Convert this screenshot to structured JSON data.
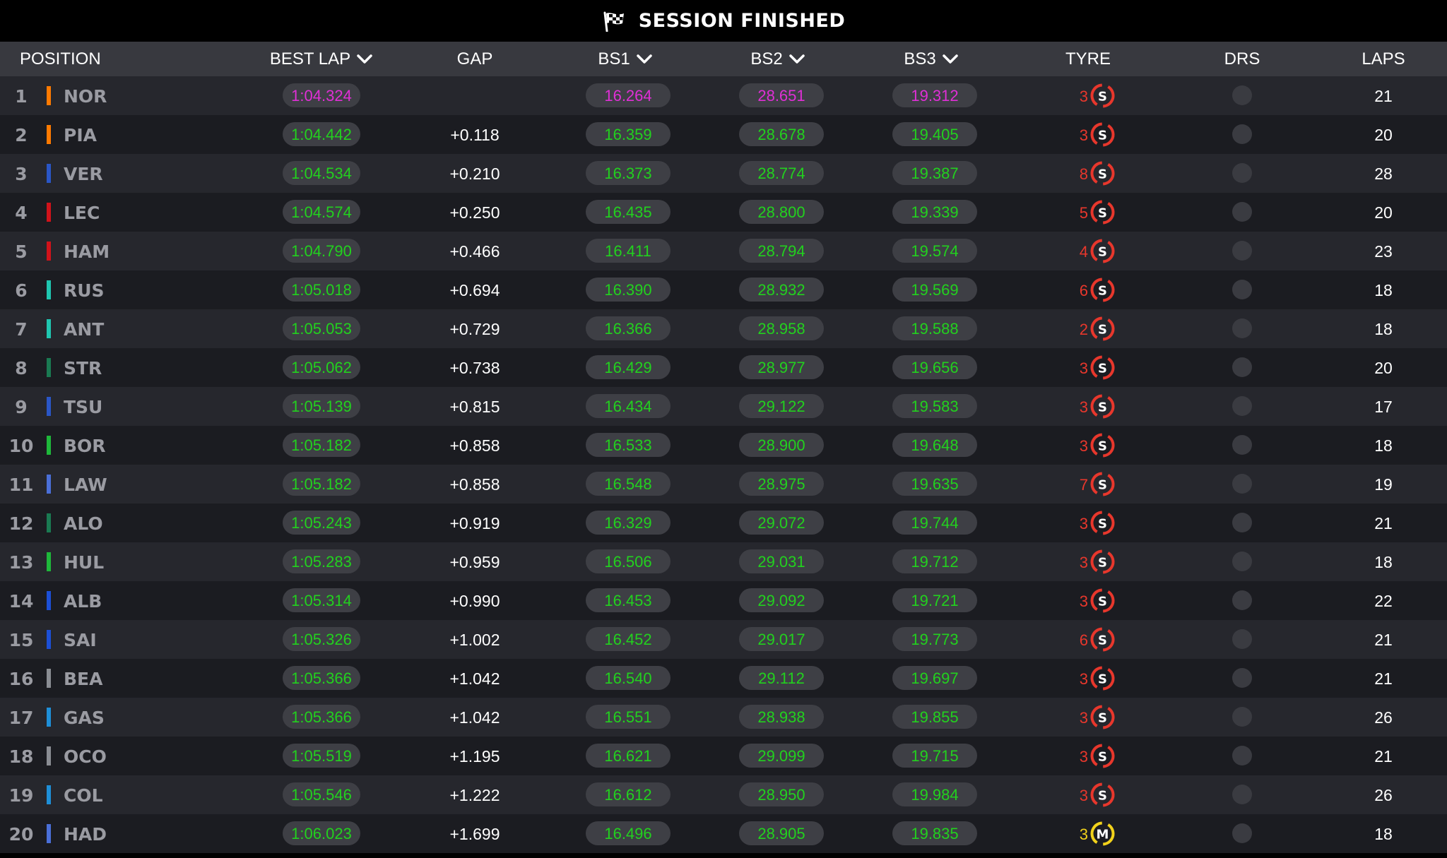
{
  "banner": {
    "title": "SESSION FINISHED",
    "icon": "checkered-flag-icon"
  },
  "columns": {
    "position": "POSITION",
    "best_lap": "BEST LAP",
    "gap": "GAP",
    "bs1": "BS1",
    "bs2": "BS2",
    "bs3": "BS3",
    "tyre": "TYRE",
    "drs": "DRS",
    "laps": "LAPS"
  },
  "colors": {
    "personal_best": "#22d11e",
    "overall_best": "#e02fd6",
    "soft_tyre": "#e8372c",
    "medium_tyre": "#f2d21b"
  },
  "rows": [
    {
      "pos": "1",
      "driver": "NOR",
      "team_color": "#ff7a00",
      "best_lap": "1:04.324",
      "best_lap_purple": true,
      "gap": "",
      "bs1": "16.264",
      "bs1_purple": true,
      "bs2": "28.651",
      "bs2_purple": true,
      "bs3": "19.312",
      "bs3_purple": true,
      "tyre_age": "3",
      "tyre": "S",
      "laps": "21"
    },
    {
      "pos": "2",
      "driver": "PIA",
      "team_color": "#ff7a00",
      "best_lap": "1:04.442",
      "gap": "+0.118",
      "bs1": "16.359",
      "bs2": "28.678",
      "bs3": "19.405",
      "tyre_age": "3",
      "tyre": "S",
      "laps": "20"
    },
    {
      "pos": "3",
      "driver": "VER",
      "team_color": "#2a56c6",
      "best_lap": "1:04.534",
      "gap": "+0.210",
      "bs1": "16.373",
      "bs2": "28.774",
      "bs3": "19.387",
      "tyre_age": "8",
      "tyre": "S",
      "laps": "28"
    },
    {
      "pos": "4",
      "driver": "LEC",
      "team_color": "#d1121a",
      "best_lap": "1:04.574",
      "gap": "+0.250",
      "bs1": "16.435",
      "bs2": "28.800",
      "bs3": "19.339",
      "tyre_age": "5",
      "tyre": "S",
      "laps": "20"
    },
    {
      "pos": "5",
      "driver": "HAM",
      "team_color": "#d1121a",
      "best_lap": "1:04.790",
      "gap": "+0.466",
      "bs1": "16.411",
      "bs2": "28.794",
      "bs3": "19.574",
      "tyre_age": "4",
      "tyre": "S",
      "laps": "23"
    },
    {
      "pos": "6",
      "driver": "RUS",
      "team_color": "#1fc6b0",
      "best_lap": "1:05.018",
      "gap": "+0.694",
      "bs1": "16.390",
      "bs2": "28.932",
      "bs3": "19.569",
      "tyre_age": "6",
      "tyre": "S",
      "laps": "18"
    },
    {
      "pos": "7",
      "driver": "ANT",
      "team_color": "#1fc6b0",
      "best_lap": "1:05.053",
      "gap": "+0.729",
      "bs1": "16.366",
      "bs2": "28.958",
      "bs3": "19.588",
      "tyre_age": "2",
      "tyre": "S",
      "laps": "18"
    },
    {
      "pos": "8",
      "driver": "STR",
      "team_color": "#1a7a52",
      "best_lap": "1:05.062",
      "gap": "+0.738",
      "bs1": "16.429",
      "bs2": "28.977",
      "bs3": "19.656",
      "tyre_age": "3",
      "tyre": "S",
      "laps": "20"
    },
    {
      "pos": "9",
      "driver": "TSU",
      "team_color": "#2a56c6",
      "best_lap": "1:05.139",
      "gap": "+0.815",
      "bs1": "16.434",
      "bs2": "29.122",
      "bs3": "19.583",
      "tyre_age": "3",
      "tyre": "S",
      "laps": "17"
    },
    {
      "pos": "10",
      "driver": "BOR",
      "team_color": "#1eb83a",
      "best_lap": "1:05.182",
      "gap": "+0.858",
      "bs1": "16.533",
      "bs2": "28.900",
      "bs3": "19.648",
      "tyre_age": "3",
      "tyre": "S",
      "laps": "18"
    },
    {
      "pos": "11",
      "driver": "LAW",
      "team_color": "#4a6fd8",
      "best_lap": "1:05.182",
      "gap": "+0.858",
      "bs1": "16.548",
      "bs2": "28.975",
      "bs3": "19.635",
      "tyre_age": "7",
      "tyre": "S",
      "laps": "19"
    },
    {
      "pos": "12",
      "driver": "ALO",
      "team_color": "#1a7a52",
      "best_lap": "1:05.243",
      "gap": "+0.919",
      "bs1": "16.329",
      "bs2": "29.072",
      "bs3": "19.744",
      "tyre_age": "3",
      "tyre": "S",
      "laps": "21"
    },
    {
      "pos": "13",
      "driver": "HUL",
      "team_color": "#1eb83a",
      "best_lap": "1:05.283",
      "gap": "+0.959",
      "bs1": "16.506",
      "bs2": "29.031",
      "bs3": "19.712",
      "tyre_age": "3",
      "tyre": "S",
      "laps": "18"
    },
    {
      "pos": "14",
      "driver": "ALB",
      "team_color": "#1c4fd6",
      "best_lap": "1:05.314",
      "gap": "+0.990",
      "bs1": "16.453",
      "bs2": "29.092",
      "bs3": "19.721",
      "tyre_age": "3",
      "tyre": "S",
      "laps": "22"
    },
    {
      "pos": "15",
      "driver": "SAI",
      "team_color": "#1c4fd6",
      "best_lap": "1:05.326",
      "gap": "+1.002",
      "bs1": "16.452",
      "bs2": "29.017",
      "bs3": "19.773",
      "tyre_age": "6",
      "tyre": "S",
      "laps": "21"
    },
    {
      "pos": "16",
      "driver": "BEA",
      "team_color": "#8a8d93",
      "best_lap": "1:05.366",
      "gap": "+1.042",
      "bs1": "16.540",
      "bs2": "29.112",
      "bs3": "19.697",
      "tyre_age": "3",
      "tyre": "S",
      "laps": "21"
    },
    {
      "pos": "17",
      "driver": "GAS",
      "team_color": "#1e8fd8",
      "best_lap": "1:05.366",
      "gap": "+1.042",
      "bs1": "16.551",
      "bs2": "28.938",
      "bs3": "19.855",
      "tyre_age": "3",
      "tyre": "S",
      "laps": "26"
    },
    {
      "pos": "18",
      "driver": "OCO",
      "team_color": "#8a8d93",
      "best_lap": "1:05.519",
      "gap": "+1.195",
      "bs1": "16.621",
      "bs2": "29.099",
      "bs3": "19.715",
      "tyre_age": "3",
      "tyre": "S",
      "laps": "21"
    },
    {
      "pos": "19",
      "driver": "COL",
      "team_color": "#1e8fd8",
      "best_lap": "1:05.546",
      "gap": "+1.222",
      "bs1": "16.612",
      "bs2": "28.950",
      "bs3": "19.984",
      "tyre_age": "3",
      "tyre": "S",
      "laps": "26"
    },
    {
      "pos": "20",
      "driver": "HAD",
      "team_color": "#4a6fd8",
      "best_lap": "1:06.023",
      "gap": "+1.699",
      "bs1": "16.496",
      "bs2": "28.905",
      "bs3": "19.835",
      "tyre_age": "3",
      "tyre": "M",
      "laps": "18"
    }
  ]
}
